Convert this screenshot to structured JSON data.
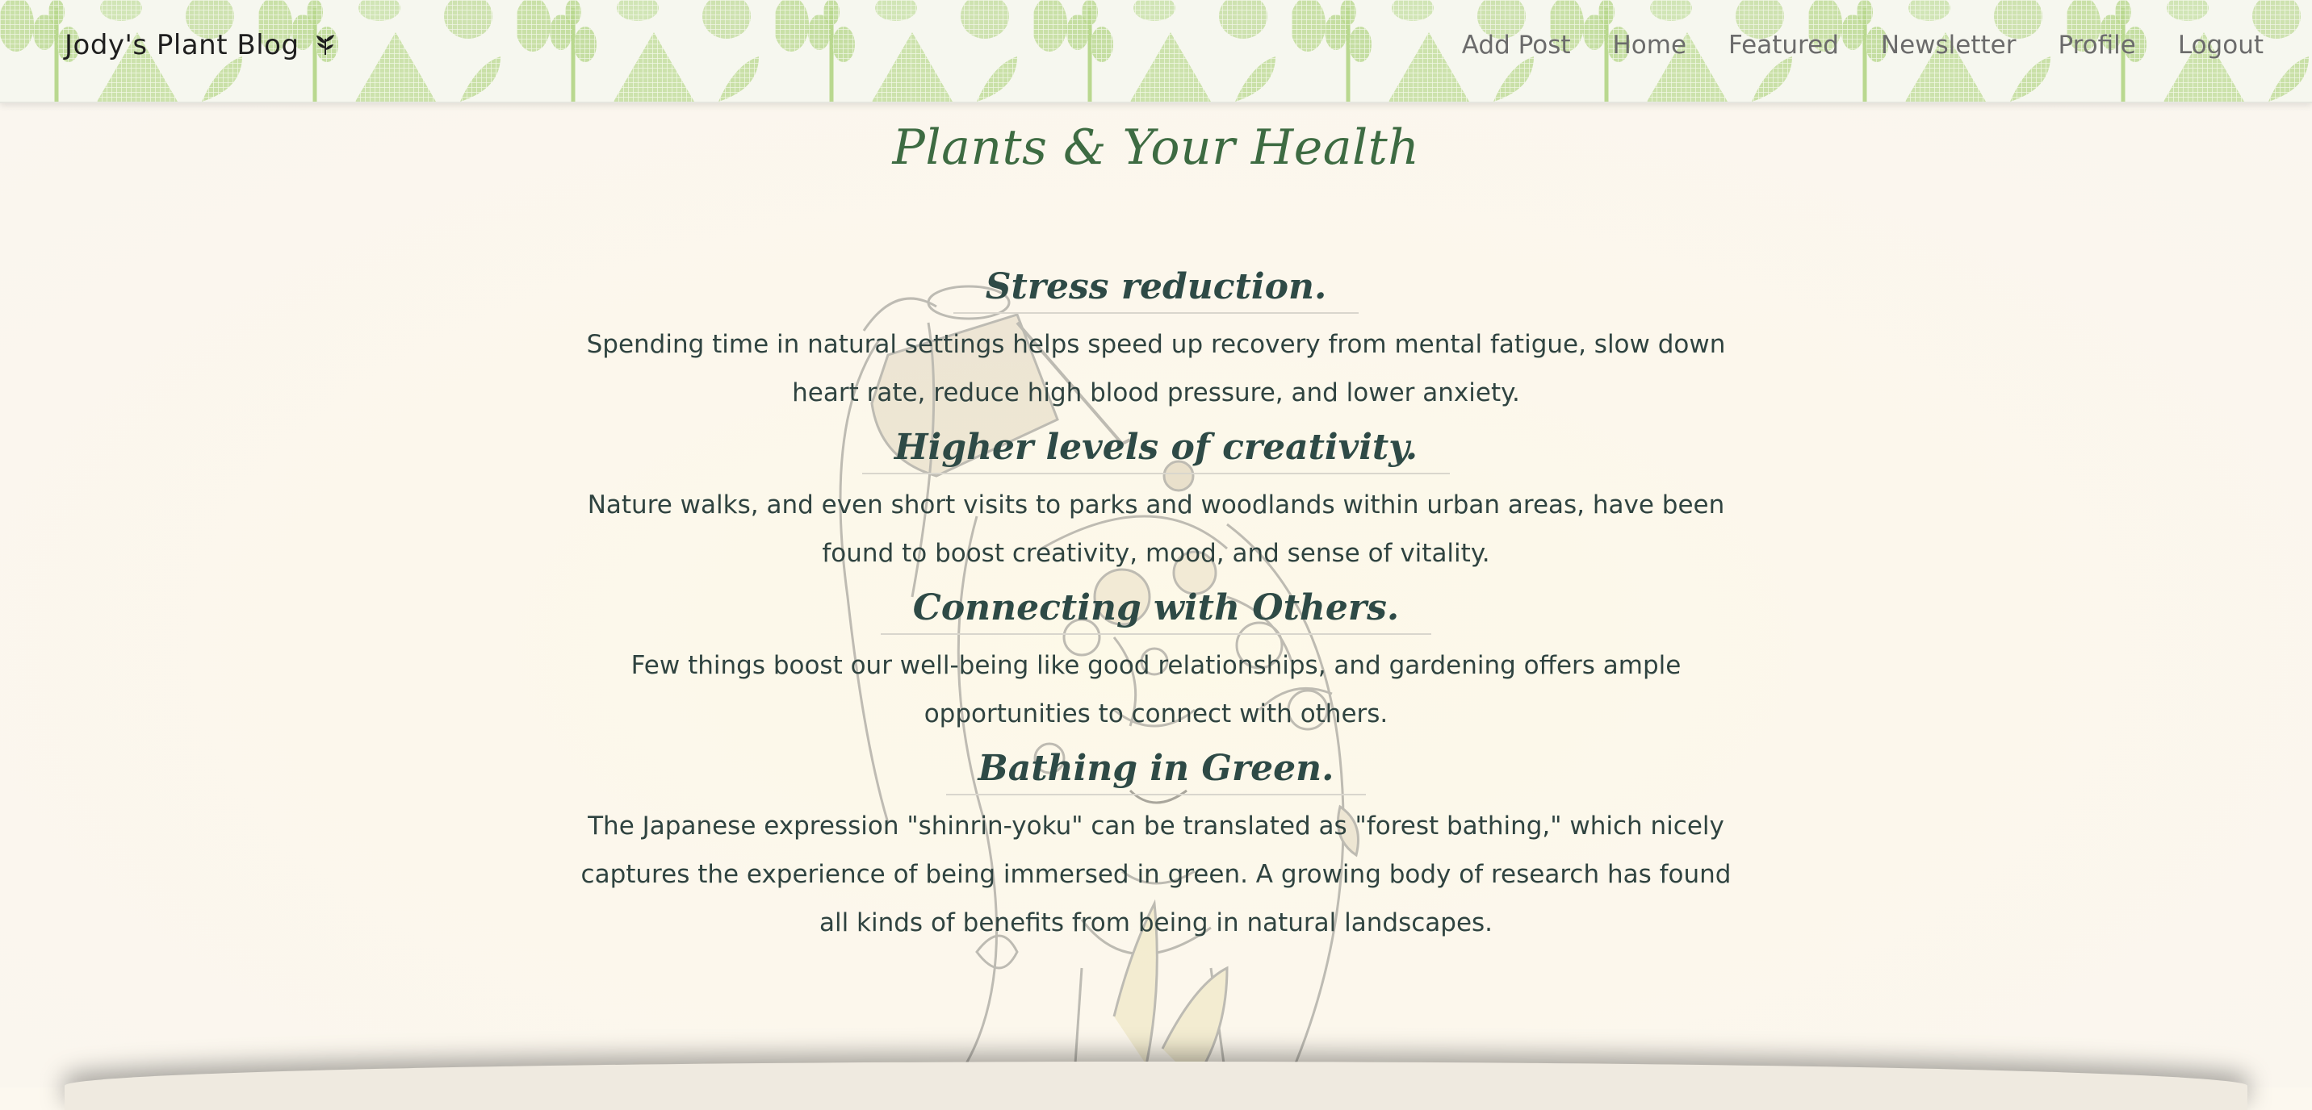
{
  "navbar": {
    "brand": "Jody's Plant Blog",
    "brand_icon": "plant-sprout-icon",
    "links": [
      "Add Post",
      "Home",
      "Featured",
      "Newsletter",
      "Profile",
      "Logout"
    ]
  },
  "page": {
    "title": "Plants & Your Health"
  },
  "sections": [
    {
      "heading": "Stress reduction.",
      "body": "Spending time in natural settings helps speed up recovery from mental fatigue, slow down heart rate, reduce high blood pressure, and lower anxiety."
    },
    {
      "heading": "Higher levels of creativity.",
      "body": "Nature walks, and even short visits to parks and woodlands within urban areas, have been found to boost creativity, mood, and sense of vitality."
    },
    {
      "heading": "Connecting with Others.",
      "body": "Few things boost our well-being like good relationships, and gardening offers ample opportunities to connect with others."
    },
    {
      "heading": "Bathing in Green.",
      "body": "The Japanese expression \"shinrin-yoku\" can be translated as \"forest bathing,\" which nicely captures the experience of being immersed in green. A growing body of research has found all kinds of benefits from being in natural landscapes."
    }
  ],
  "colors": {
    "title": "#3d6b42",
    "heading": "#2e4a46",
    "body_text": "#2f4340",
    "nav_link": "#6b6b6b",
    "background": "#fcf8ef",
    "pattern_green": "#a8cc7e"
  }
}
